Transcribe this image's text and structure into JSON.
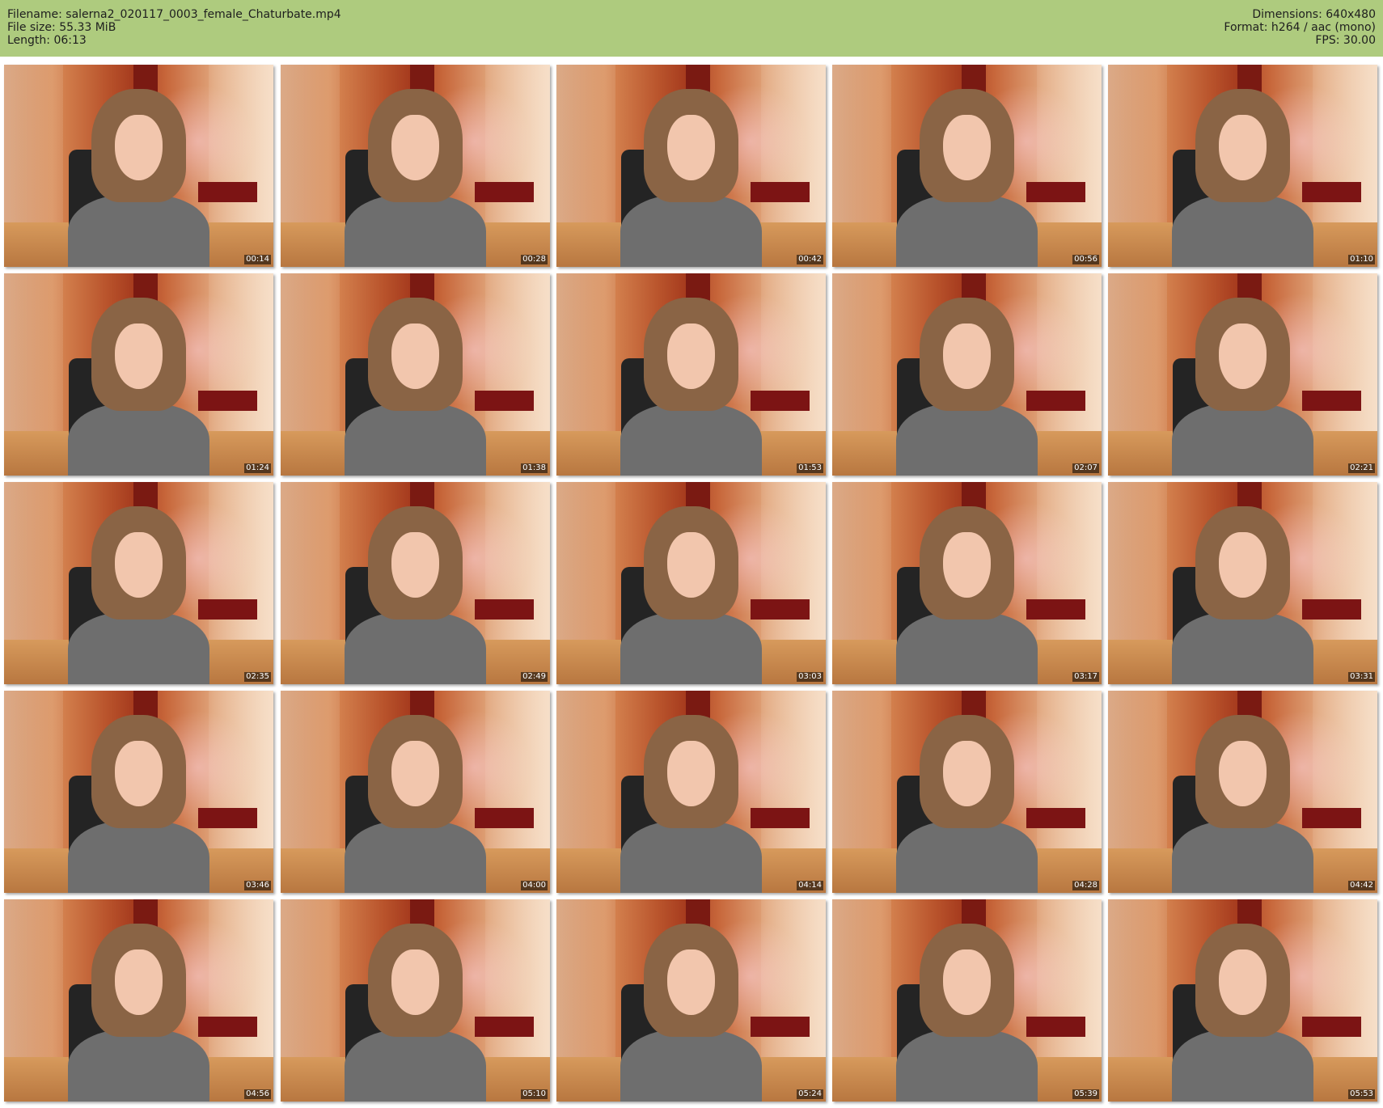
{
  "header": {
    "filename": "Filename: salerna2_020117_0003_female_Chaturbate.mp4",
    "filesize": "File size: 55.33 MiB",
    "length": "Length: 06:13",
    "dimensions": "Dimensions: 640x480",
    "format": "Format: h264 / aac (mono)",
    "fps": "FPS: 30.00"
  },
  "colors": {
    "header_bg": "#aecb7e",
    "timestamp_bg": "#000000"
  },
  "thumbnails": [
    {
      "timestamp": "00:14"
    },
    {
      "timestamp": "00:28"
    },
    {
      "timestamp": "00:42"
    },
    {
      "timestamp": "00:56"
    },
    {
      "timestamp": "01:10"
    },
    {
      "timestamp": "01:24"
    },
    {
      "timestamp": "01:38"
    },
    {
      "timestamp": "01:53"
    },
    {
      "timestamp": "02:07"
    },
    {
      "timestamp": "02:21"
    },
    {
      "timestamp": "02:35"
    },
    {
      "timestamp": "02:49"
    },
    {
      "timestamp": "03:03"
    },
    {
      "timestamp": "03:17"
    },
    {
      "timestamp": "03:31"
    },
    {
      "timestamp": "03:46"
    },
    {
      "timestamp": "04:00"
    },
    {
      "timestamp": "04:14"
    },
    {
      "timestamp": "04:28"
    },
    {
      "timestamp": "04:42"
    },
    {
      "timestamp": "04:56"
    },
    {
      "timestamp": "05:10"
    },
    {
      "timestamp": "05:24"
    },
    {
      "timestamp": "05:39"
    },
    {
      "timestamp": "05:53"
    }
  ]
}
